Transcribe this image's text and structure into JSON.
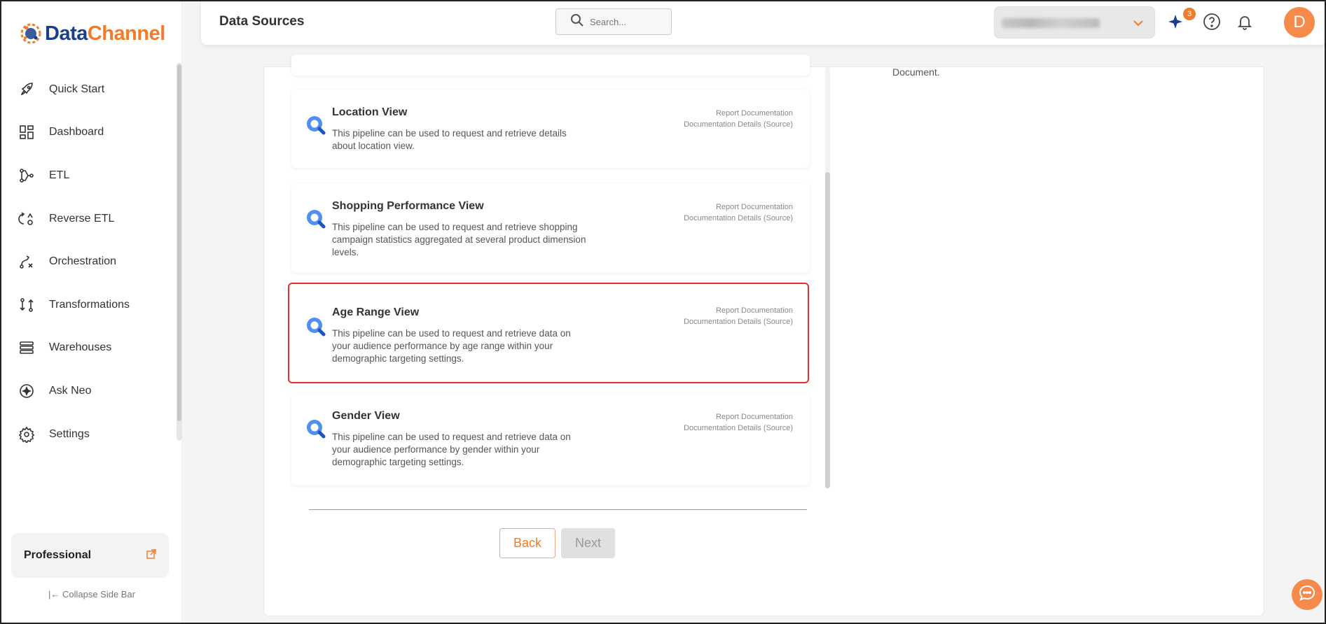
{
  "app": {
    "logo_data": "Data",
    "logo_channel": "Channel"
  },
  "sidebar": {
    "items": [
      {
        "label": "Quick Start",
        "icon": "rocket-icon"
      },
      {
        "label": "Dashboard",
        "icon": "dashboard-icon"
      },
      {
        "label": "ETL",
        "icon": "etl-icon"
      },
      {
        "label": "Reverse ETL",
        "icon": "reverse-etl-icon"
      },
      {
        "label": "Orchestration",
        "icon": "orchestration-icon"
      },
      {
        "label": "Transformations",
        "icon": "transformations-icon"
      },
      {
        "label": "Warehouses",
        "icon": "warehouses-icon"
      },
      {
        "label": "Ask Neo",
        "icon": "ask-neo-icon"
      },
      {
        "label": "Settings",
        "icon": "gear-icon"
      }
    ],
    "plan_name": "Professional",
    "collapse_label": "Collapse Side Bar"
  },
  "header": {
    "title": "Data Sources",
    "search_placeholder": "Search...",
    "notification_count": "3",
    "avatar_initial": "D"
  },
  "main": {
    "right_text": "Document.",
    "cards": [
      {
        "title": "Location View",
        "desc": "This pipeline can be used to request and retrieve details about location view.",
        "link1": "Report Documentation",
        "link2": "Documentation Details (Source)"
      },
      {
        "title": "Shopping Performance View",
        "desc": "This pipeline can be used to request and retrieve shopping campaign statistics aggregated at several product dimension levels.",
        "link1": "Report Documentation",
        "link2": "Documentation Details (Source)"
      },
      {
        "title": "Age Range View",
        "desc": "This pipeline can be used to request and retrieve data on your audience performance by age range within your demographic targeting settings.",
        "link1": "Report Documentation",
        "link2": "Documentation Details (Source)",
        "selected": true
      },
      {
        "title": "Gender View",
        "desc": "This pipeline can be used to request and retrieve data on your audience performance by gender within your demographic targeting settings.",
        "link1": "Report Documentation",
        "link2": "Documentation Details (Source)"
      }
    ],
    "back_label": "Back",
    "next_label": "Next"
  },
  "colors": {
    "brand_blue": "#1a3f8a",
    "brand_orange": "#f07b2a",
    "selected_border": "#e0312b"
  }
}
